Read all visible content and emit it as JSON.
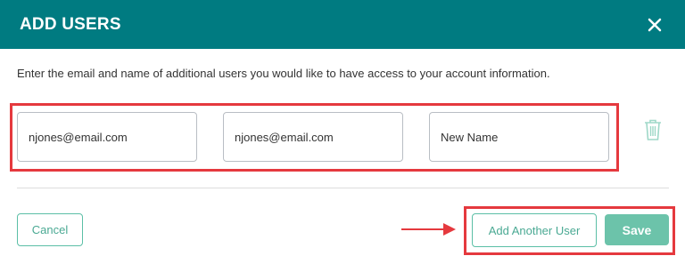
{
  "dialog": {
    "title": "ADD USERS",
    "description": "Enter the email and name of additional users you would like to have access to your account information."
  },
  "fields": [
    {
      "value": "njones@email.com"
    },
    {
      "value": "njones@email.com"
    },
    {
      "value": "New Name"
    }
  ],
  "buttons": {
    "cancel": "Cancel",
    "add_another": "Add Another User",
    "save": "Save"
  },
  "icons": {
    "close": "close-icon",
    "delete": "trash-icon",
    "pointer": "arrow-right-icon"
  },
  "colors": {
    "header": "#007b81",
    "accent": "#6cc3aa",
    "highlight": "#e5393e"
  }
}
